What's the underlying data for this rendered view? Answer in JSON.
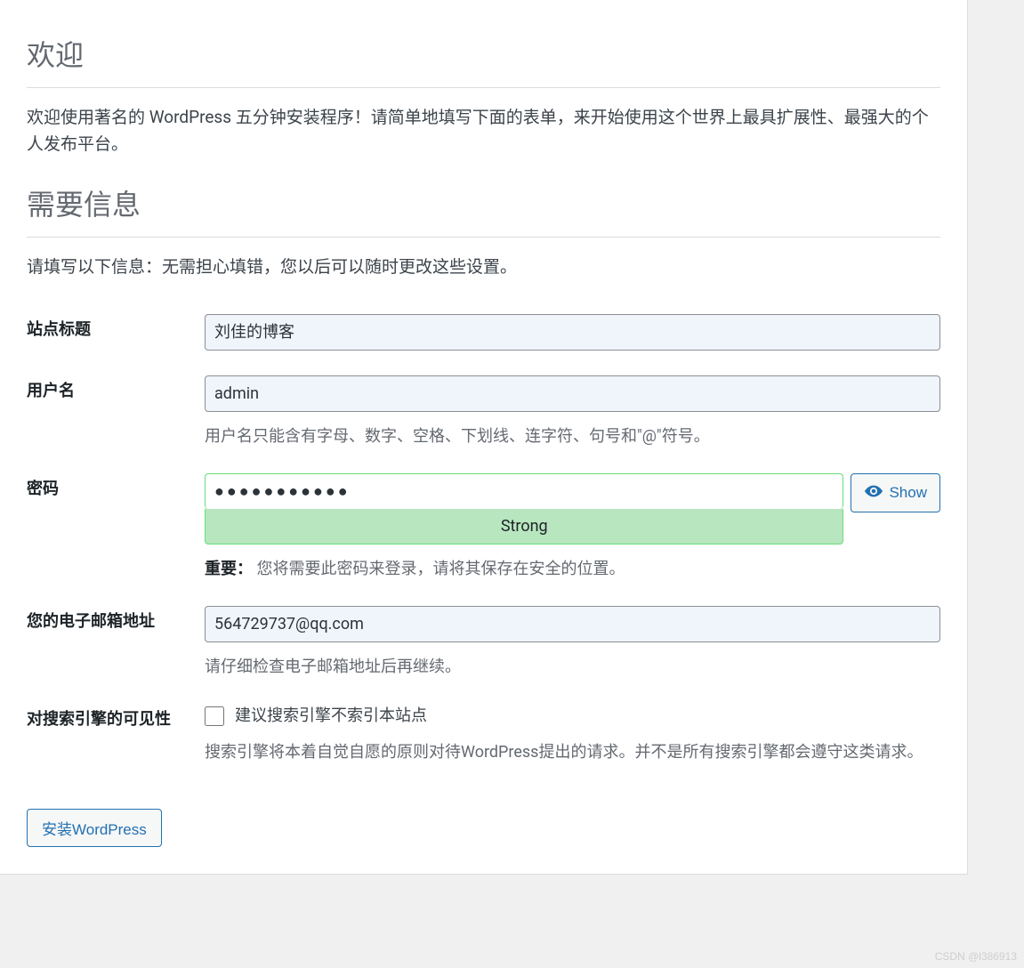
{
  "headings": {
    "welcome": "欢迎",
    "info_needed": "需要信息"
  },
  "intro": {
    "welcome_text": "欢迎使用著名的 WordPress 五分钟安装程序！请简单地填写下面的表单，来开始使用这个世界上最具扩展性、最强大的个人发布平台。",
    "info_text": "请填写以下信息：无需担心填错，您以后可以随时更改这些设置。"
  },
  "fields": {
    "site_title": {
      "label": "站点标题",
      "value": "刘佳的博客"
    },
    "username": {
      "label": "用户名",
      "value": "admin",
      "hint": "用户名只能含有字母、数字、空格、下划线、连字符、句号和\"@\"符号。"
    },
    "password": {
      "label": "密码",
      "masked": "●●●●●●●●●●●",
      "strength": "Strong",
      "show_label": "Show",
      "important_label": "重要：",
      "important_text": "您将需要此密码来登录，请将其保存在安全的位置。"
    },
    "email": {
      "label": "您的电子邮箱地址",
      "value": "564729737@qq.com",
      "hint": "请仔细检查电子邮箱地址后再继续。"
    },
    "search_visibility": {
      "label": "对搜索引擎的可见性",
      "checkbox_label": "建议搜索引擎不索引本站点",
      "hint": "搜索引擎将本着自觉自愿的原则对待WordPress提出的请求。并不是所有搜索引擎都会遵守这类请求。"
    }
  },
  "submit": {
    "label": "安装WordPress"
  },
  "watermark": "CSDN @l386913"
}
